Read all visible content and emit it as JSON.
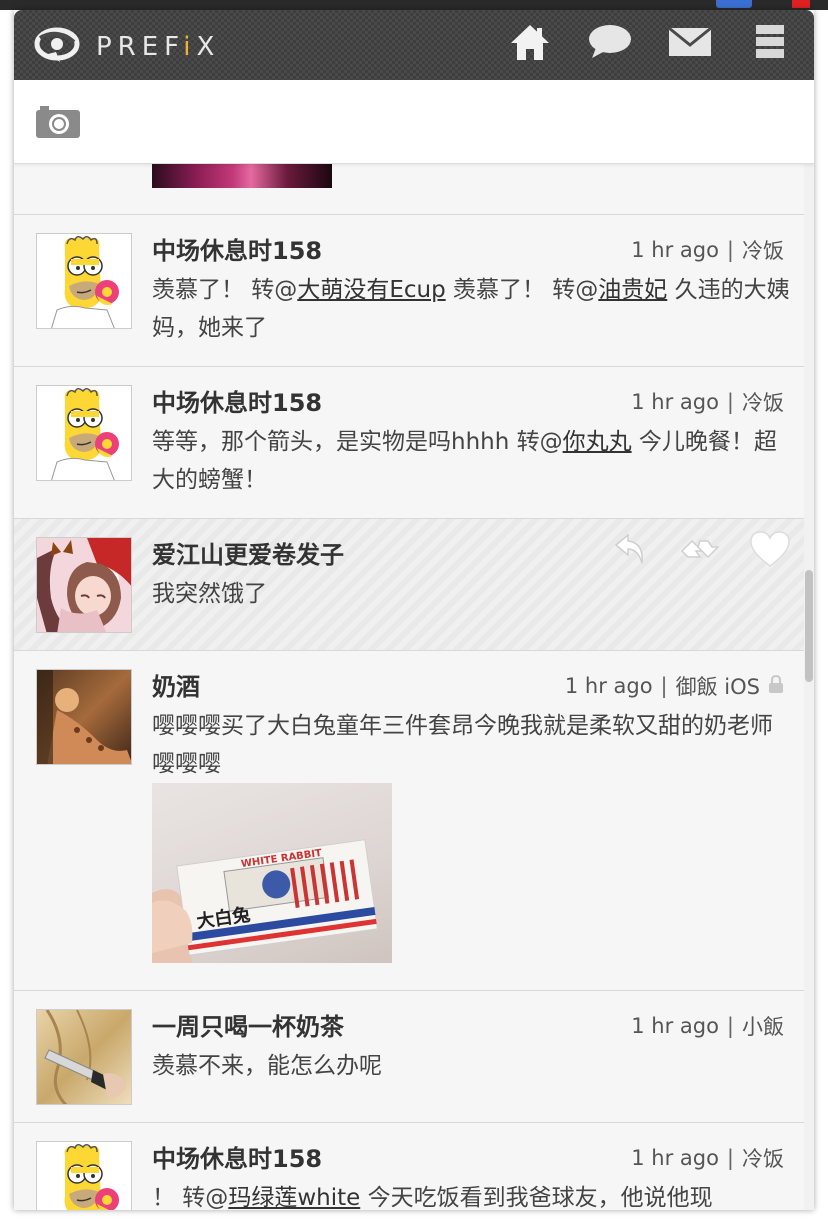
{
  "app": {
    "logo_text_pre": "PREF",
    "logo_text_accent": "i",
    "logo_text_post": "X",
    "accent_color": "#f2b134"
  },
  "header": {
    "buttons": [
      {
        "name": "home-button",
        "icon": "home-icon"
      },
      {
        "name": "messages-button",
        "icon": "speech-bubble-icon"
      },
      {
        "name": "mail-button",
        "icon": "envelope-icon"
      },
      {
        "name": "menu-button",
        "icon": "hamburger-icon"
      }
    ]
  },
  "compose": {
    "icon": "camera-icon"
  },
  "feed": {
    "posts": [
      {
        "name": "中场休息时158",
        "time": "1 hr ago",
        "source": "冷饭",
        "avatar": "homer",
        "text_parts": [
          "羡慕了！ 转@",
          "大萌没有Ecup",
          " 羡慕了！ 转@",
          "油贵妃",
          " 久违的大姨妈，她来了"
        ]
      },
      {
        "name": "中场休息时158",
        "time": "1 hr ago",
        "source": "冷饭",
        "avatar": "homer",
        "text_parts": [
          "等等，那个箭头，是实物是吗hhhh 转@",
          "你丸丸",
          " 今儿晚餐！超大的螃蟹！"
        ]
      },
      {
        "name": "爱江山更爱卷发子",
        "avatar": "anime",
        "text": "我突然饿了",
        "actions": [
          "reply-icon",
          "retweet-icon",
          "heart-icon"
        ]
      },
      {
        "name": "奶酒",
        "time": "1 hr ago",
        "source": "御飯 iOS",
        "locked": true,
        "avatar": "photo-warm",
        "text": "嘤嘤嘤买了大白兔童年三件套昂今晚我就是柔软又甜的奶老师嘤嘤嘤",
        "image": {
          "brand": "WHITE RABBIT",
          "label": "大白兔"
        }
      },
      {
        "name": "一周只喝一杯奶茶",
        "time": "1 hr ago",
        "source": "小飯",
        "avatar": "photo-knife",
        "text": "羡慕不来，能怎么办呢"
      },
      {
        "name": "中场休息时158",
        "time": "1 hr ago",
        "source": "冷饭",
        "avatar": "homer",
        "text_parts": [
          "！ 转@",
          "玛绿莲white",
          " 今天吃饭看到我爸球友，他说他现"
        ]
      }
    ]
  }
}
